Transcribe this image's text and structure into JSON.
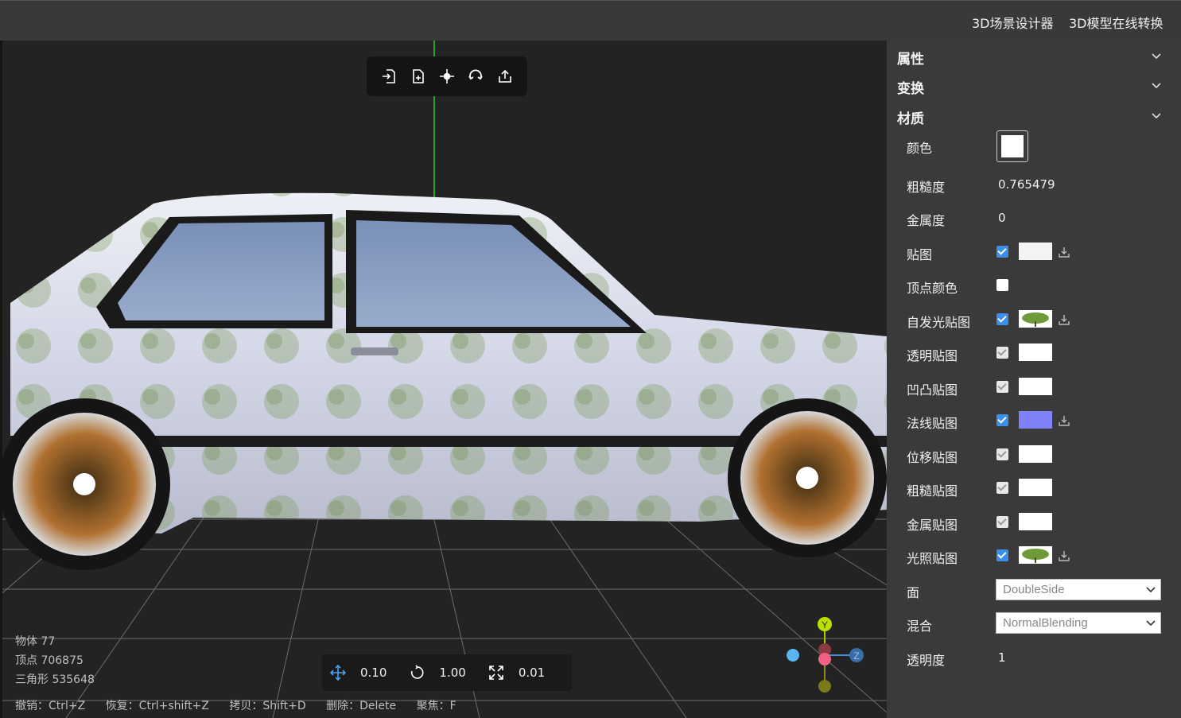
{
  "topbar": {
    "link_scene_designer": "3D场景设计器",
    "link_model_convert": "3D模型在线转换"
  },
  "toolbar": {
    "icons": [
      "import-icon",
      "export-file-icon",
      "focus-center-icon",
      "reset-rotate-icon",
      "share-upload-icon"
    ]
  },
  "stats": {
    "objects": "物体 77",
    "vertices": "顶点 706875",
    "triangles": "三角形 535648"
  },
  "shortcuts": {
    "undo": "撤销：Ctrl+Z",
    "redo": "恢复：Ctrl+shift+Z",
    "copy": "拷贝：Shift+D",
    "delete": "删除：Delete",
    "focus": "聚焦：F"
  },
  "snap": {
    "translate": "0.10",
    "rotate": "1.00",
    "scale": "0.01"
  },
  "gizmo": {
    "y_label": "Y",
    "z_label": "Z"
  },
  "panel": {
    "section_properties": "属性",
    "section_transform": "变换",
    "section_material": "材质",
    "color_label": "颜色",
    "color_value": "#ffffff",
    "roughness_label": "粗糙度",
    "roughness_value": "0.765479",
    "metalness_label": "金属度",
    "metalness_value": "0",
    "map_label": "贴图",
    "vertex_colors_label": "顶点颜色",
    "emissive_map_label": "自发光贴图",
    "alpha_map_label": "透明贴图",
    "bump_map_label": "凹凸贴图",
    "normal_map_label": "法线贴图",
    "displacement_map_label": "位移贴图",
    "roughness_map_label": "粗糙贴图",
    "metalness_map_label": "金属贴图",
    "light_map_label": "光照贴图",
    "side_label": "面",
    "side_value": "DoubleSide",
    "blending_label": "混合",
    "blending_value": "NormalBlending",
    "opacity_label": "透明度",
    "opacity_value": "1",
    "normal_swatch_color": "#8080f8"
  }
}
